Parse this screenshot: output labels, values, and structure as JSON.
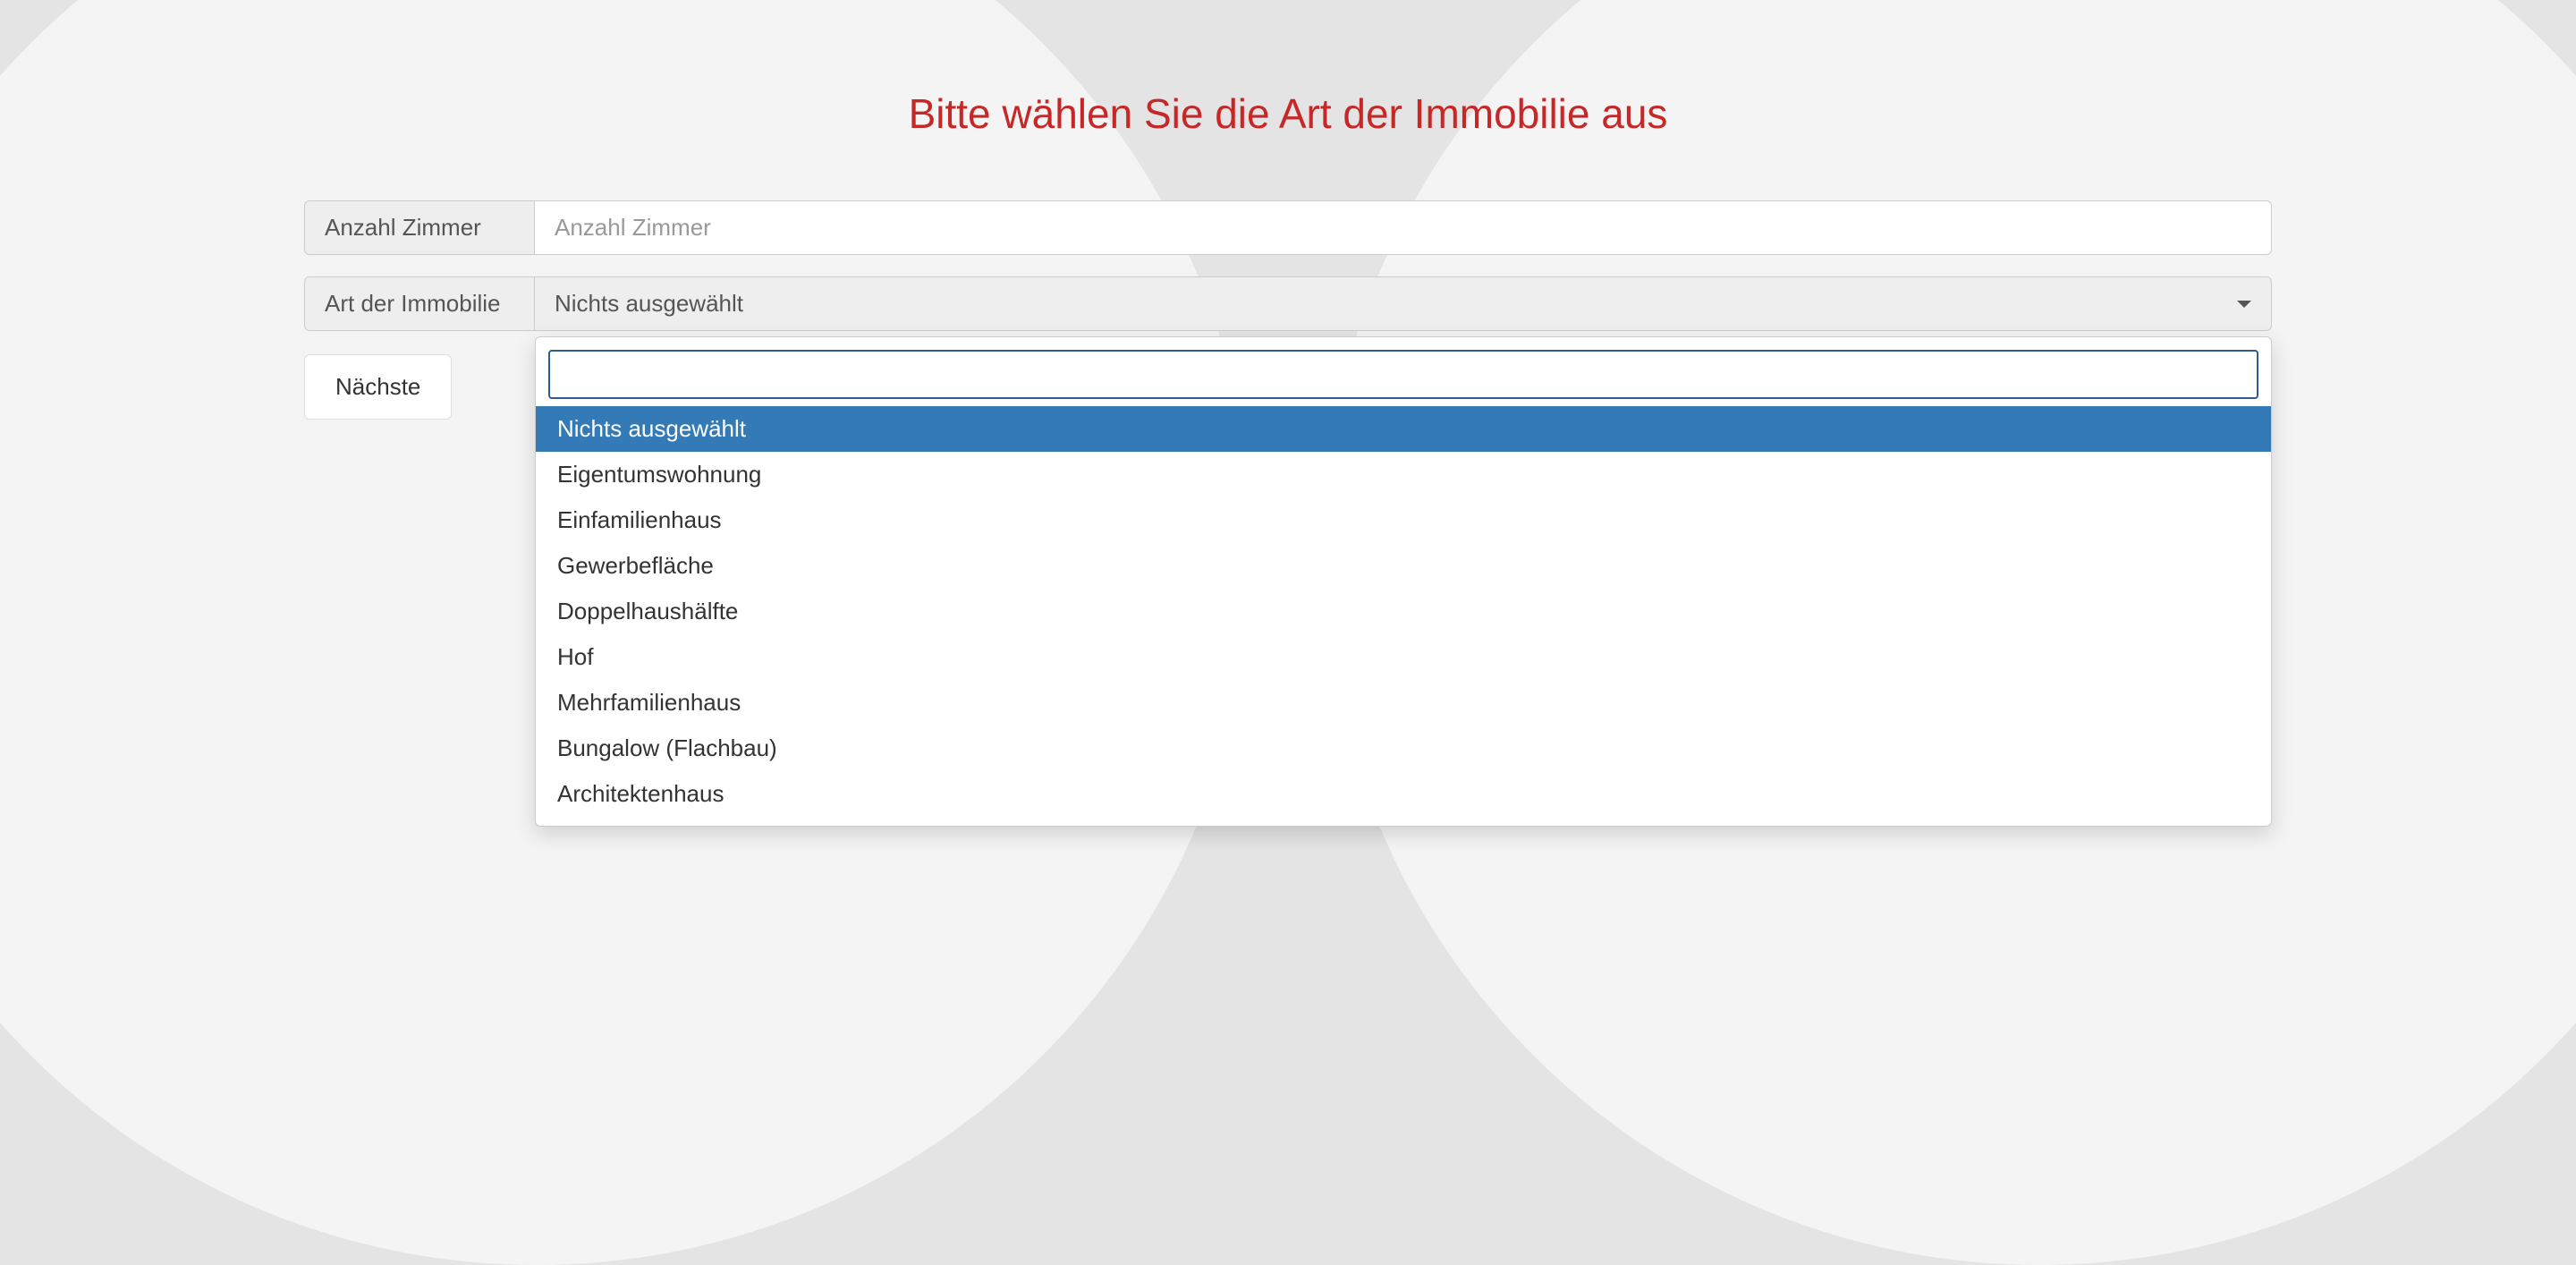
{
  "page": {
    "title": "Bitte wählen Sie die Art der Immobilie aus"
  },
  "form": {
    "rooms": {
      "label": "Anzahl Zimmer",
      "placeholder": "Anzahl Zimmer",
      "value": ""
    },
    "property_type": {
      "label": "Art der Immobilie",
      "selected": "Nichts ausgewählt",
      "search_value": "",
      "options": [
        "Nichts ausgewählt",
        "Eigentumswohnung",
        "Einfamilienhaus",
        "Gewerbefläche",
        "Doppelhaushälfte",
        "Hof",
        "Mehrfamilienhaus",
        "Bungalow (Flachbau)",
        "Architektenhaus"
      ],
      "selected_index": 0
    },
    "next_label": "Nächste"
  }
}
